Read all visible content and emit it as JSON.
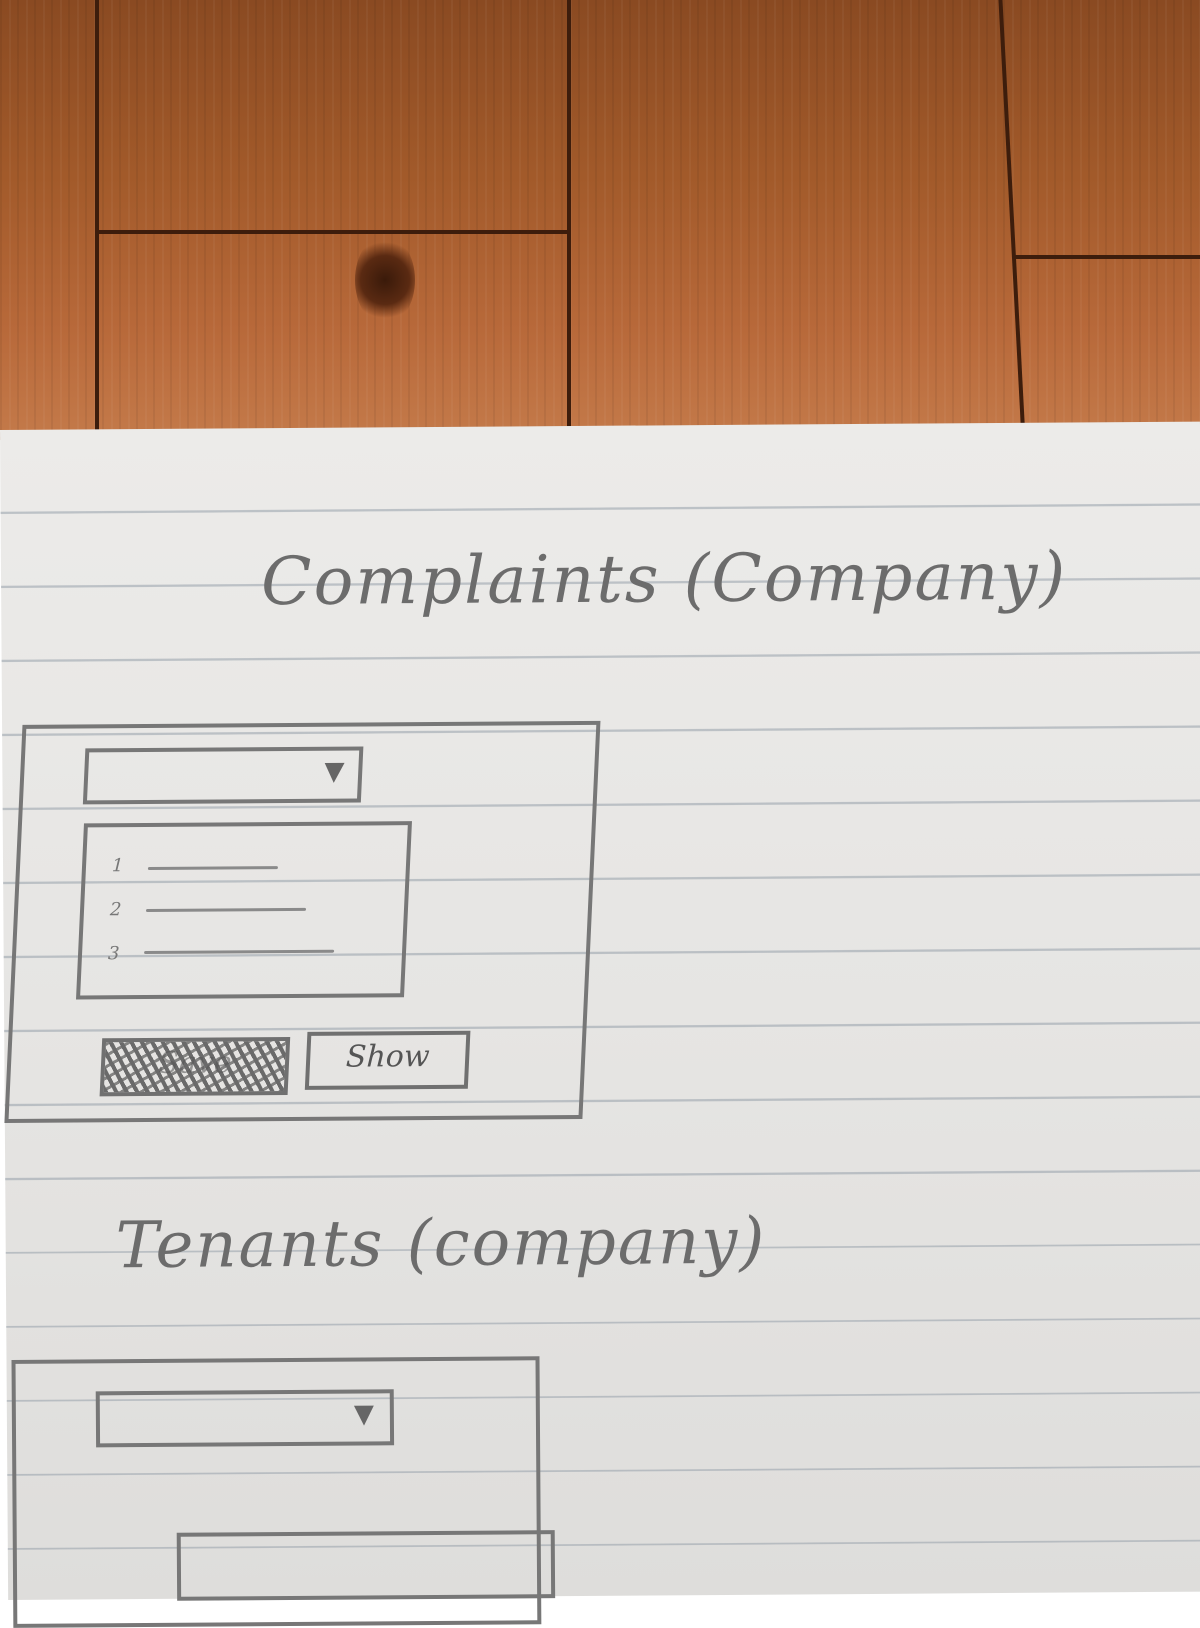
{
  "sections": [
    {
      "title": "Complaints (Company)",
      "items": [
        "1",
        "2",
        "3"
      ],
      "buttons": {
        "save": "Save",
        "show": "Show"
      }
    },
    {
      "title": "Tenants (company)"
    }
  ],
  "icons": {
    "dropdown": "triangle-down-icon"
  },
  "colors": {
    "pencil": "#6c6c6c",
    "paper": "#e8e7e5",
    "floor": "#a25a2a"
  }
}
